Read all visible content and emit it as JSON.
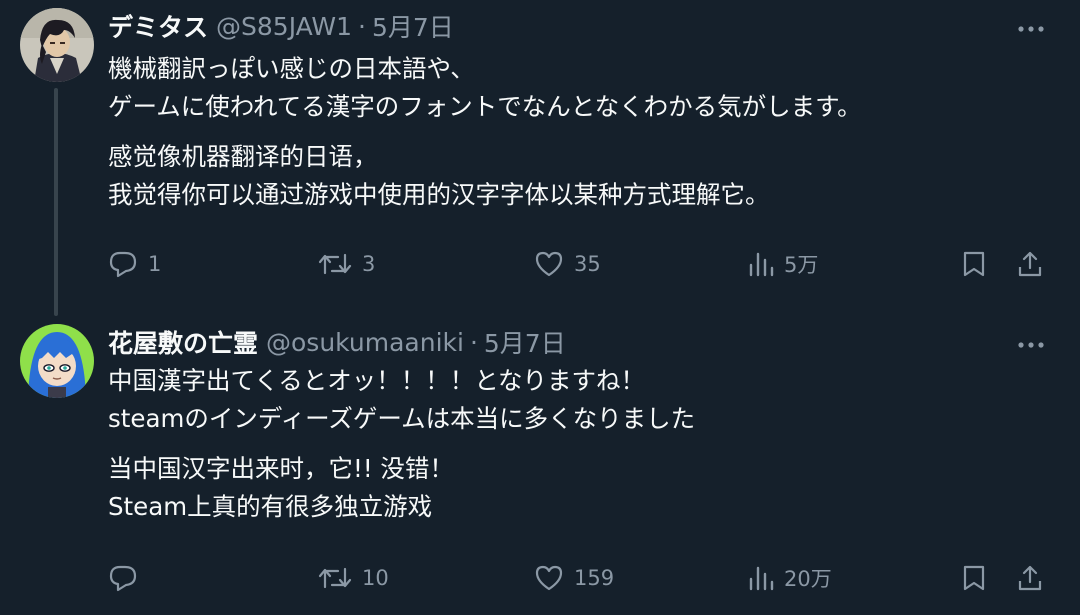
{
  "tweets": [
    {
      "display_name": "デミタス",
      "handle": "@S85JAW1",
      "separator": "·",
      "date": "5月7日",
      "paragraphs": [
        [
          "機械翻訳っぽい感じの日本語や、",
          "ゲームに使われてる漢字のフォントでなんとなくわかる気がします。"
        ],
        [
          "感觉像机器翻译的日语，",
          "我觉得你可以通过游戏中使用的汉字字体以某种方式理解它。"
        ]
      ],
      "replies": "1",
      "retweets": "3",
      "likes": "35",
      "views": "5万"
    },
    {
      "display_name": "花屋敷の亡霊",
      "handle": "@osukumaaniki",
      "separator": "·",
      "date": "5月7日",
      "paragraphs": [
        [
          "中国漢字出てくるとオッ！！！！となりますね！",
          "steamのインディーズゲームは本当に多くなりました"
        ],
        [
          "当中国汉字出来时，它!! 没错！",
          "Steam上真的有很多独立游戏"
        ]
      ],
      "replies": "",
      "retweets": "10",
      "likes": "159",
      "views": "20万"
    }
  ],
  "icons": {
    "more": "more-horizontal-icon",
    "reply": "reply-icon",
    "retweet": "retweet-icon",
    "like": "heart-icon",
    "views": "views-icon",
    "bookmark": "bookmark-icon",
    "share": "share-icon"
  },
  "colors": {
    "background": "#15202b",
    "text_primary": "#f7f9f9",
    "text_secondary": "#8b98a5",
    "thread_line": "#38444d"
  }
}
